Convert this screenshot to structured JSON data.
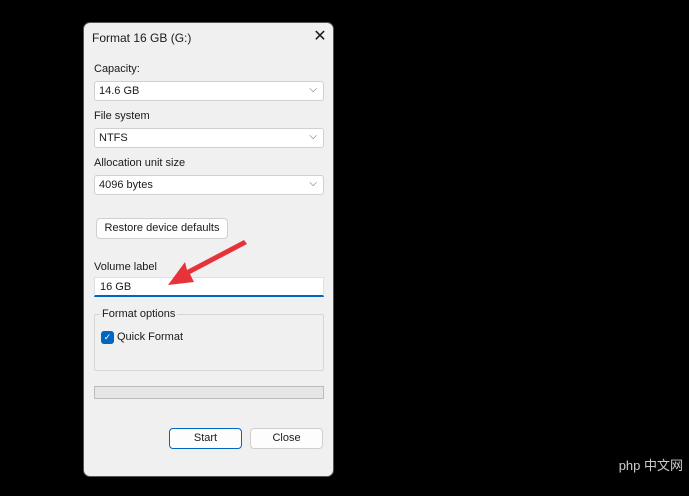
{
  "dialog": {
    "title": "Format 16 GB (G:)",
    "capacity": {
      "label": "Capacity:",
      "value": "14.6 GB"
    },
    "file_system": {
      "label": "File system",
      "value": "NTFS"
    },
    "allocation": {
      "label": "Allocation unit size",
      "value": "4096 bytes"
    },
    "restore_label": "Restore device defaults",
    "volume": {
      "label": "Volume label",
      "value": "16 GB"
    },
    "format_options": {
      "legend": "Format options",
      "quick_format": "Quick Format",
      "quick_format_checked": true
    },
    "progress_percent": 0,
    "start_label": "Start",
    "close_label": "Close"
  },
  "watermark": "php 中文网",
  "colors": {
    "accent": "#0067c0",
    "arrow": "#e8323a"
  }
}
